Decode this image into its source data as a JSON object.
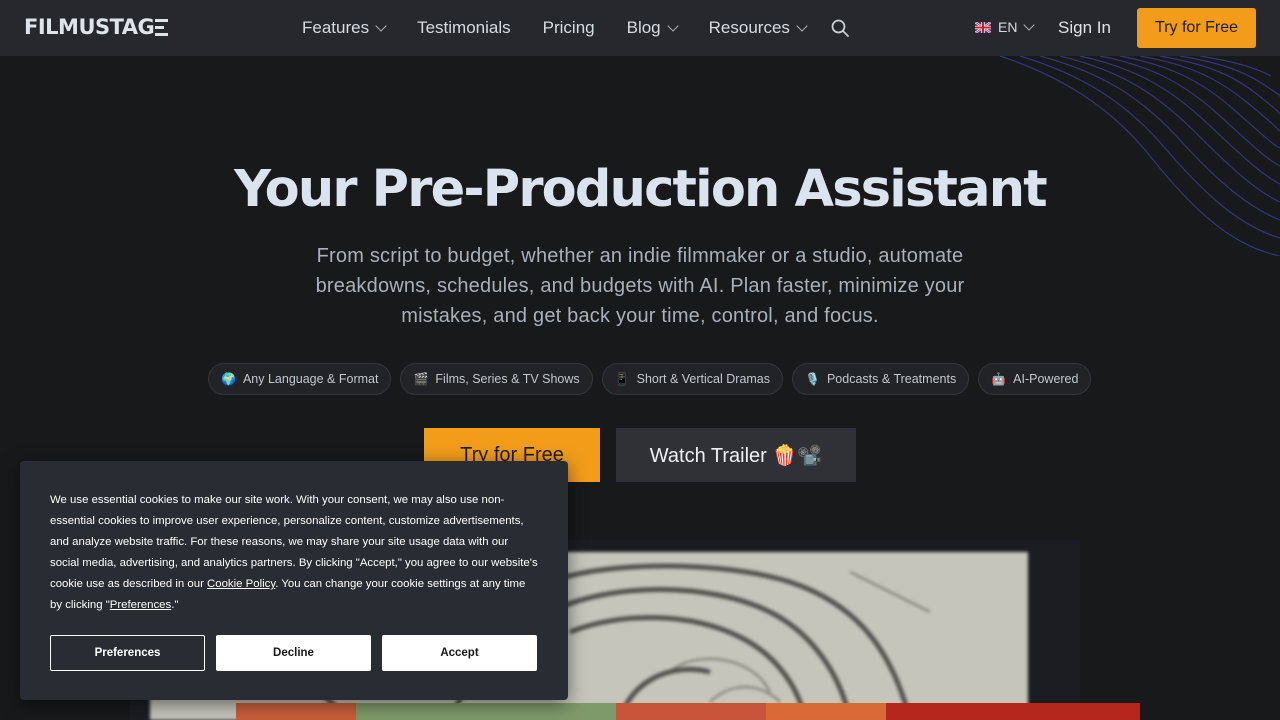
{
  "brand": {
    "logo_text": "FILMUSTAG",
    "logo_glyph": "E"
  },
  "nav": {
    "links": [
      {
        "label": "Features",
        "dropdown": true
      },
      {
        "label": "Testimonials",
        "dropdown": false
      },
      {
        "label": "Pricing",
        "dropdown": false
      },
      {
        "label": "Blog",
        "dropdown": true
      },
      {
        "label": "Resources",
        "dropdown": true
      }
    ],
    "search_icon": "search-icon",
    "language": "EN",
    "sign_in": "Sign In",
    "cta": "Try for Free"
  },
  "hero": {
    "title": "Your Pre-Production Assistant",
    "subtitle": "From script to budget, whether an indie filmmaker or a studio, automate breakdowns, schedules, and budgets with AI. Plan faster, minimize your mistakes, and get back your time, control, and focus.",
    "pills": [
      {
        "icon": "🌍",
        "label": "Any Language & Format"
      },
      {
        "icon": "🎬",
        "label": "Films, Series & TV Shows"
      },
      {
        "icon": "📱",
        "label": "Short & Vertical Dramas"
      },
      {
        "icon": "🎙️",
        "label": "Podcasts & Treatments"
      },
      {
        "icon": "🤖",
        "label": "AI-Powered"
      }
    ],
    "cta_primary": "Try for Free",
    "cta_secondary": "Watch Trailer 🍿📽️"
  },
  "cookie_banner": {
    "text_1": "We use essential cookies to make our site work. With your consent, we may also use non-essential cookies to improve user experience, personalize content, customize advertisements, and analyze website traffic. For these reasons, we may share your site usage data with our social media, advertising, and analytics partners. By clicking \"Accept,\" you agree to our website's cookie use as described in our ",
    "link_policy": "Cookie Policy",
    "text_2": ". You can change your cookie settings at any time by clicking \"",
    "link_prefs": "Preferences",
    "text_3": ".\"",
    "buttons": {
      "preferences": "Preferences",
      "decline": "Decline",
      "accept": "Accept"
    }
  },
  "colors": {
    "accent": "#f29c1a",
    "background": "#18191b",
    "navbar": "#26282d",
    "cookie_bg": "#2a2c33"
  }
}
